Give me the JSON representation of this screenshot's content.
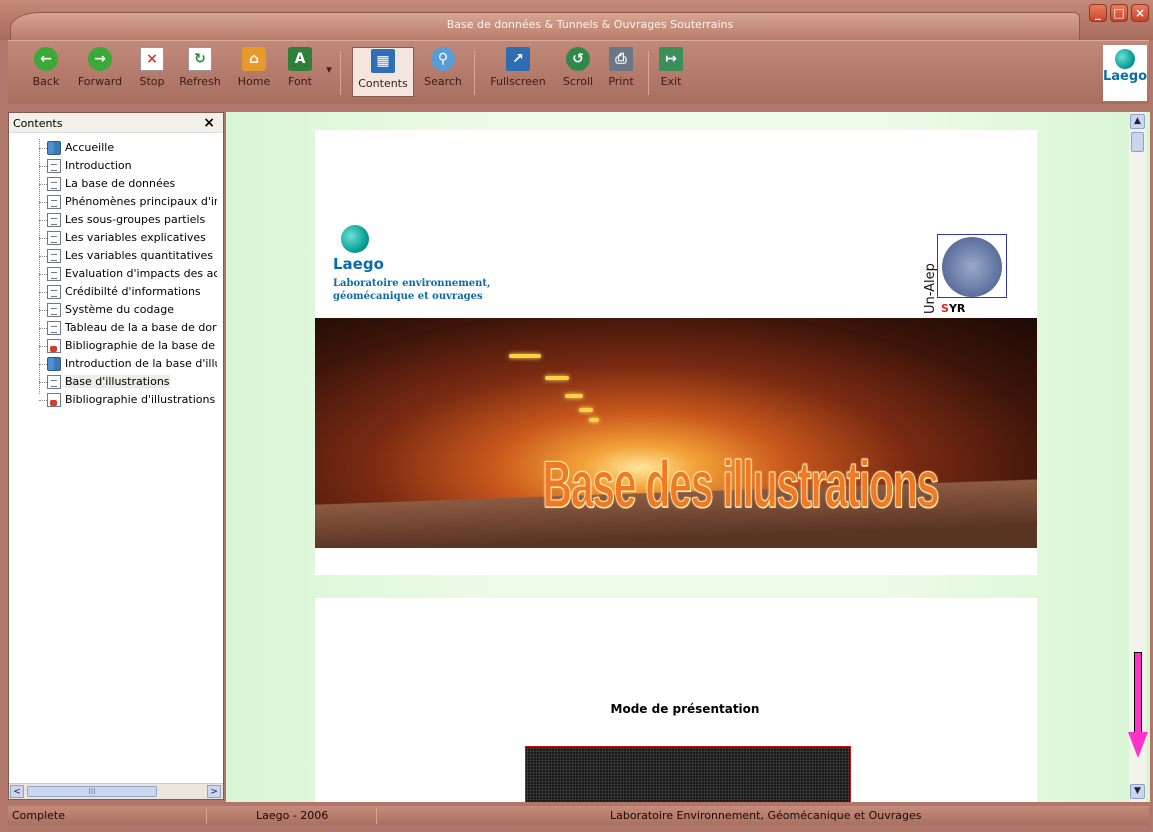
{
  "window": {
    "title": "Base de données & Tunnels & Ouvrages Souterrains",
    "controls": {
      "minimize": "_",
      "maximize": "□",
      "close": "×"
    }
  },
  "toolbar": {
    "buttons": [
      {
        "label": "Back",
        "icon": "back-arrow-icon",
        "color": "#3aa935"
      },
      {
        "label": "Forward",
        "icon": "forward-arrow-icon",
        "color": "#3aa935"
      },
      {
        "label": "Stop",
        "icon": "stop-icon",
        "color": "#d43a2a"
      },
      {
        "label": "Refresh",
        "icon": "refresh-icon",
        "color": "#2b8a3a"
      },
      {
        "label": "Home",
        "icon": "home-icon",
        "color": "#e79a2a"
      },
      {
        "label": "Font",
        "icon": "font-icon",
        "color": "#2f7e3a"
      },
      {
        "label": "Contents",
        "icon": "contents-icon",
        "color": "#2f6fb8"
      },
      {
        "label": "Search",
        "icon": "search-icon",
        "color": "#5b9bd6"
      },
      {
        "label": "Fullscreen",
        "icon": "fullscreen-icon",
        "color": "#2d6db0"
      },
      {
        "label": "Scroll",
        "icon": "scroll-icon",
        "color": "#2f8a4a"
      },
      {
        "label": "Print",
        "icon": "print-icon",
        "color": "#6b7787"
      },
      {
        "label": "Exit",
        "icon": "exit-icon",
        "color": "#3b8f5a"
      }
    ],
    "font_dropdown": "▾",
    "logo_text": "Laego"
  },
  "sidebar": {
    "title": "Contents",
    "close": "×",
    "items": [
      {
        "label": "Accueille",
        "icon": "book-icon"
      },
      {
        "label": "Introduction",
        "icon": "document-icon"
      },
      {
        "label": "La base de données",
        "icon": "document-icon"
      },
      {
        "label": "Phénomènes principaux d'in",
        "icon": "document-icon"
      },
      {
        "label": "Les sous-groupes partiels",
        "icon": "document-icon"
      },
      {
        "label": "Les variables explicatives",
        "icon": "document-icon"
      },
      {
        "label": "Les variables quantitatives",
        "icon": "document-icon"
      },
      {
        "label": "Evaluation d'impacts des ac",
        "icon": "document-icon"
      },
      {
        "label": "Crédibilté d'informations",
        "icon": "document-icon"
      },
      {
        "label": "Système du codage",
        "icon": "document-icon"
      },
      {
        "label": "Tableau de la a base de dor",
        "icon": "document-icon"
      },
      {
        "label": "Bibliographie de la base de c",
        "icon": "reference-icon"
      },
      {
        "label": "Introduction de la base d'illu",
        "icon": "book-icon"
      },
      {
        "label": "Base d'illustrations",
        "icon": "document-icon",
        "selected": true
      },
      {
        "label": "Bibliographie d'illustrations",
        "icon": "reference-icon"
      }
    ],
    "scroll_left": "<",
    "scroll_right": ">",
    "scroll_grip": "III"
  },
  "content": {
    "laego_brand": "Laego",
    "laego_sub_1": "Laboratoire environnement,",
    "laego_sub_2": "géomécanique et ouvrages",
    "uni_text": "Un-Alep",
    "syr_s": "S",
    "syr_rest": "YR",
    "banner_title": "Base des illustrations",
    "mode_title": "Mode de présentation"
  },
  "scrollbar": {
    "up": "▲",
    "down": "▼"
  },
  "status": {
    "left": "Complete",
    "middle": "Laego - 2006",
    "right": "Laboratoire Environnement, Géomécanique et Ouvrages"
  },
  "colors": {
    "frame": "#b0766a",
    "page_bg": "#eefbe9",
    "accent_pink": "#ff33c8"
  }
}
